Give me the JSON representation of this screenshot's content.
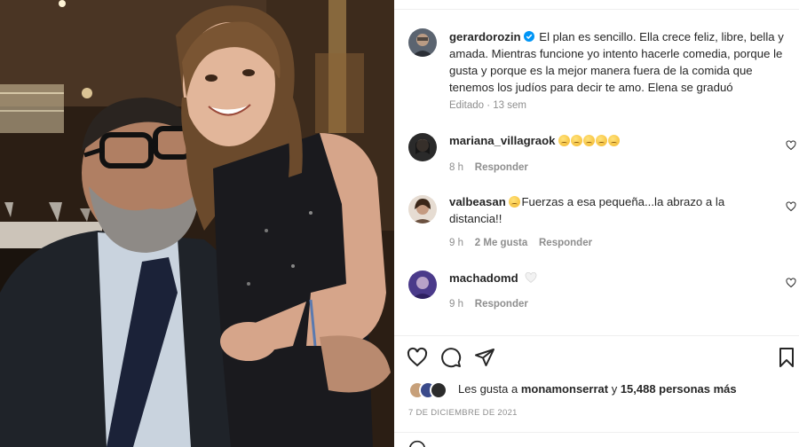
{
  "photo": {
    "description_icon": "photo-father-daughter"
  },
  "post": {
    "author": "gerardorozin",
    "caption": "El plan es sencillo. Ella crece feliz, libre, bella y amada. Mientras funcione yo intento hacerle comedia, porque le gusta y porque es la mejor manera fuera de la comida que tenemos los judíos para decir te amo. Elena se graduó",
    "edited": "Editado",
    "separator": " · ",
    "time": "13 sem"
  },
  "comments": [
    {
      "user": "mariana_villagraok",
      "text": "",
      "emoji_count": 5,
      "time": "8 h",
      "likes": "",
      "reply": "Responder"
    },
    {
      "user": "valbeasan",
      "text": "Fuerzas a esa pequeña...la abrazo a la distancia!!",
      "time": "9 h",
      "likes": "2 Me gusta",
      "reply": "Responder"
    },
    {
      "user": "machadomd",
      "text": "",
      "time": "9 h",
      "likes": "",
      "reply": "Responder"
    }
  ],
  "likes": {
    "prefix": "Les gusta a ",
    "user": "monamonserrat",
    "middle": " y ",
    "count": "15,488 personas más"
  },
  "date": "7 DE DICIEMBRE DE 2021",
  "colors": {
    "verified": "#0095f6",
    "muted": "#8e8e8e",
    "text": "#262626"
  }
}
